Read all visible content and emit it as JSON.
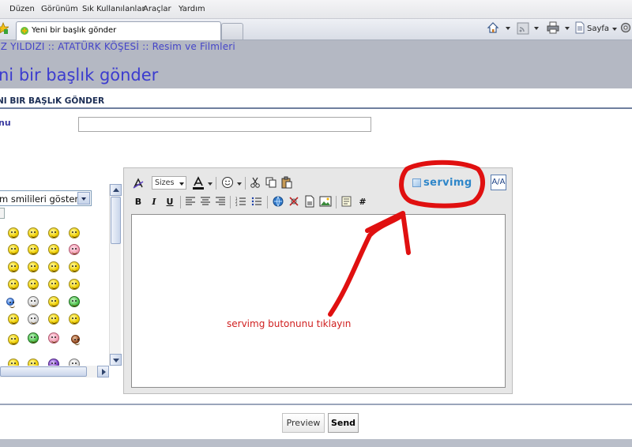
{
  "browser": {
    "menu": [
      "Düzen",
      "Görünüm",
      "Sık Kullanılanlar",
      "Araçlar",
      "Yardım"
    ],
    "tab_title": "Yeni bir başlık gönder",
    "page_menu_label": "Sayfa"
  },
  "page": {
    "breadcrumb": "IZ YILDIZI :: ATATÜRK KÖŞESİ :: Resim ve Filmleri",
    "title": "ni bir başlık gönder",
    "section_title": "NI BIR BAŞLıK GÖNDER",
    "subject_label": "nu",
    "subject_value": ""
  },
  "smilies": {
    "select_value": "m smilileri göster"
  },
  "editor": {
    "sizes_label": "Sizes",
    "servimg_label": "servimg",
    "aa_label": "A/A",
    "content": ""
  },
  "annotation": {
    "text": "servimg butonunu tıklayın",
    "color": "#e01010"
  },
  "actions": {
    "preview": "Preview",
    "send": "Send"
  }
}
